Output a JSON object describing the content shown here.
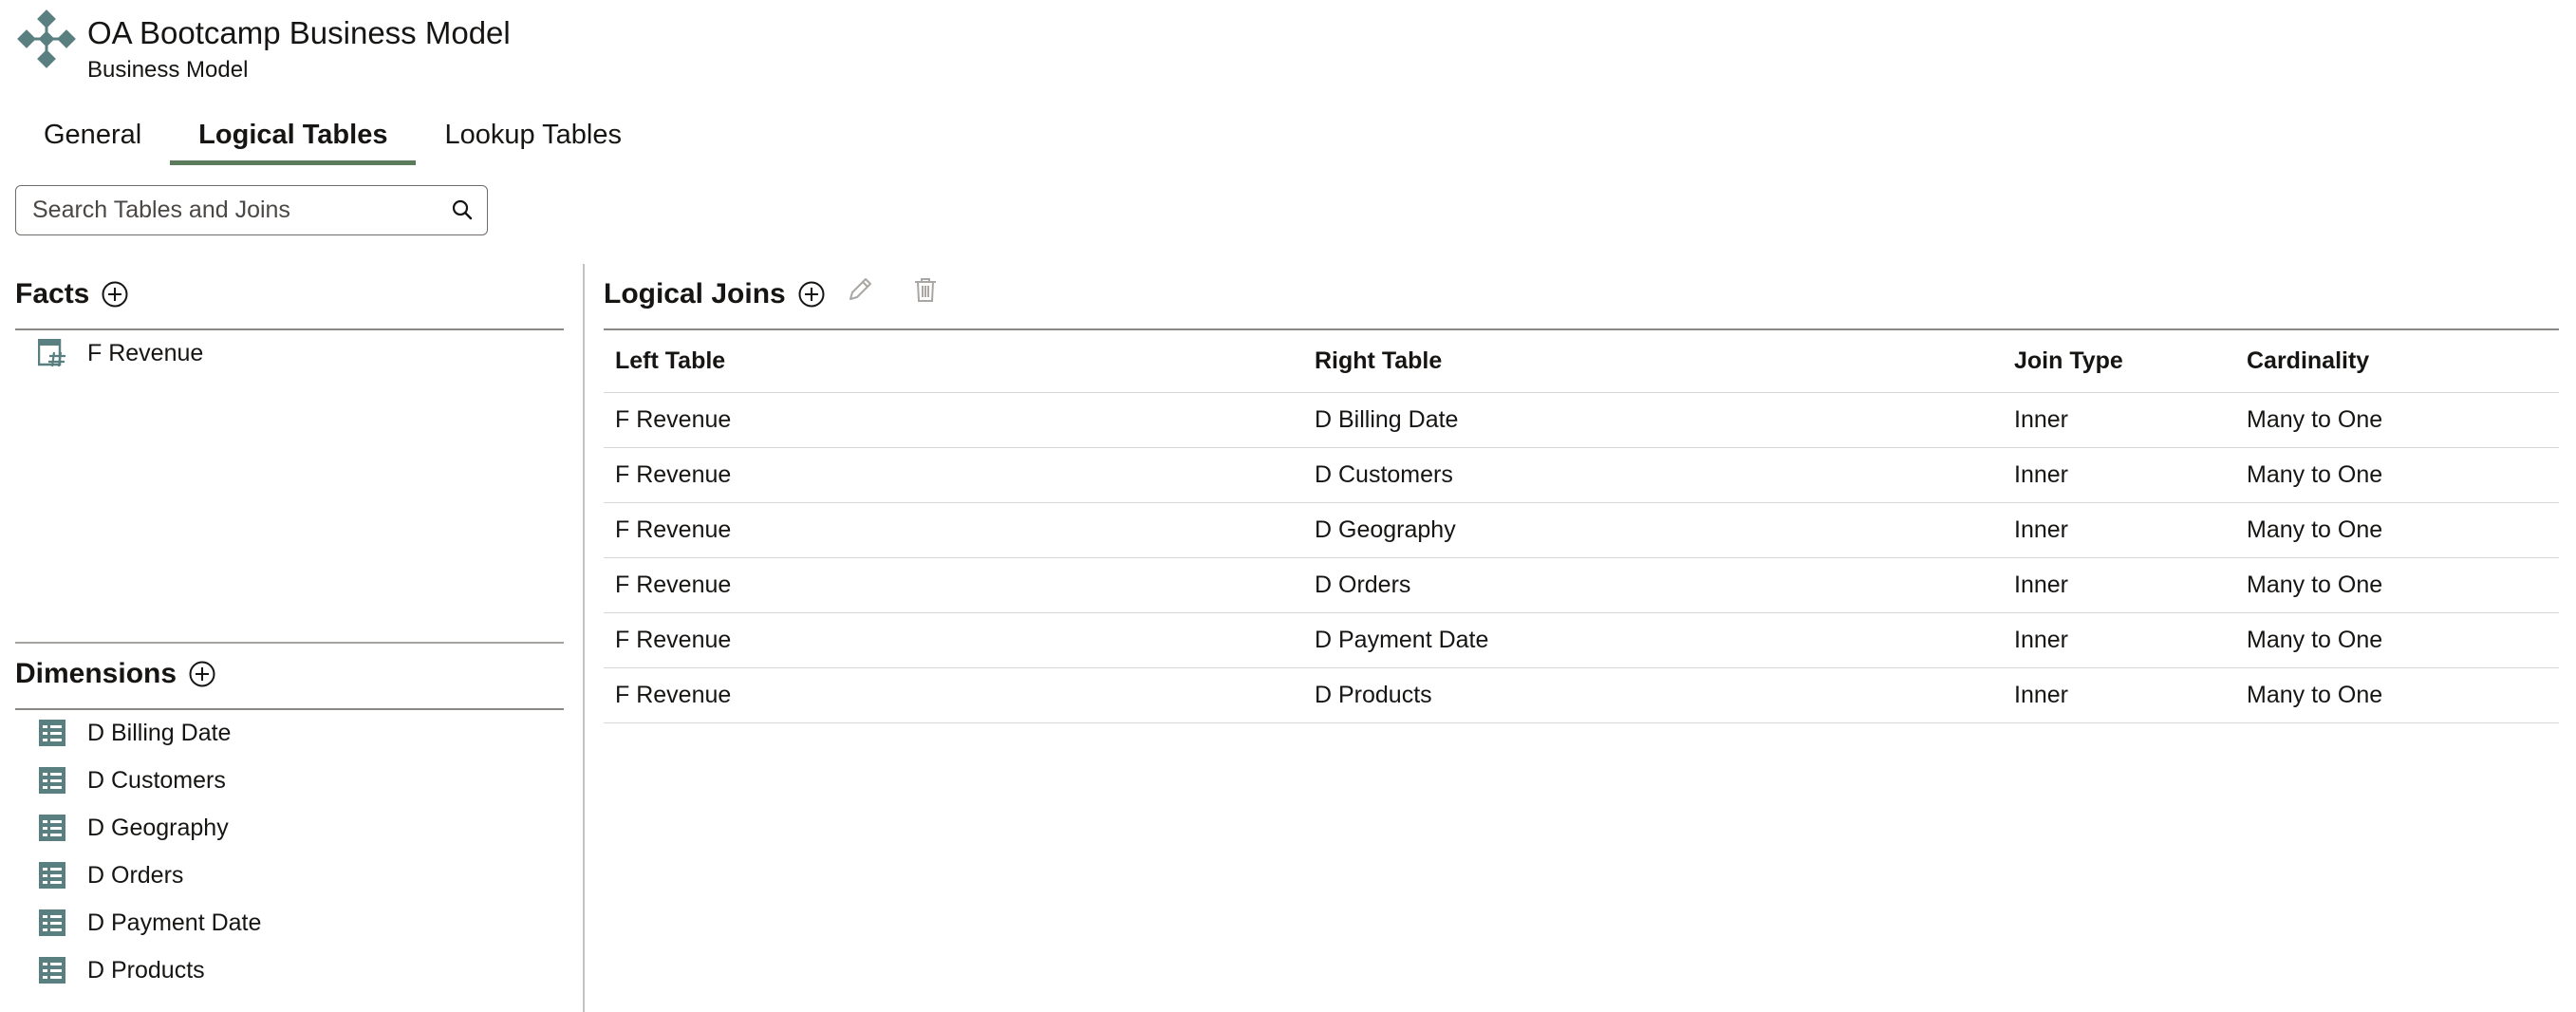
{
  "header": {
    "title": "OA Bootcamp Business Model",
    "subtitle": "Business Model",
    "logo_icon": "business-model-icon"
  },
  "tabs": [
    {
      "label": "General",
      "active": false
    },
    {
      "label": "Logical Tables",
      "active": true
    },
    {
      "label": "Lookup Tables",
      "active": false
    }
  ],
  "search": {
    "placeholder": "Search Tables and Joins",
    "value": ""
  },
  "facts": {
    "title": "Facts",
    "items": [
      {
        "label": "F Revenue",
        "icon": "fact-table-icon"
      }
    ]
  },
  "dimensions": {
    "title": "Dimensions",
    "items": [
      {
        "label": "D Billing Date",
        "icon": "dimension-table-icon"
      },
      {
        "label": "D Customers",
        "icon": "dimension-table-icon"
      },
      {
        "label": "D Geography",
        "icon": "dimension-table-icon"
      },
      {
        "label": "D Orders",
        "icon": "dimension-table-icon"
      },
      {
        "label": "D Payment Date",
        "icon": "dimension-table-icon"
      },
      {
        "label": "D Products",
        "icon": "dimension-table-icon"
      }
    ]
  },
  "joins": {
    "title": "Logical Joins",
    "columns": [
      "Left Table",
      "Right Table",
      "Join Type",
      "Cardinality"
    ],
    "rows": [
      [
        "F Revenue",
        "D Billing Date",
        "Inner",
        "Many to One"
      ],
      [
        "F Revenue",
        "D Customers",
        "Inner",
        "Many to One"
      ],
      [
        "F Revenue",
        "D Geography",
        "Inner",
        "Many to One"
      ],
      [
        "F Revenue",
        "D Orders",
        "Inner",
        "Many to One"
      ],
      [
        "F Revenue",
        "D Payment Date",
        "Inner",
        "Many to One"
      ],
      [
        "F Revenue",
        "D Products",
        "Inner",
        "Many to One"
      ]
    ]
  },
  "colors": {
    "accent": "#5c7b5a",
    "icon": "#5a7f80",
    "disabled_icon": "#a9a6a3"
  }
}
